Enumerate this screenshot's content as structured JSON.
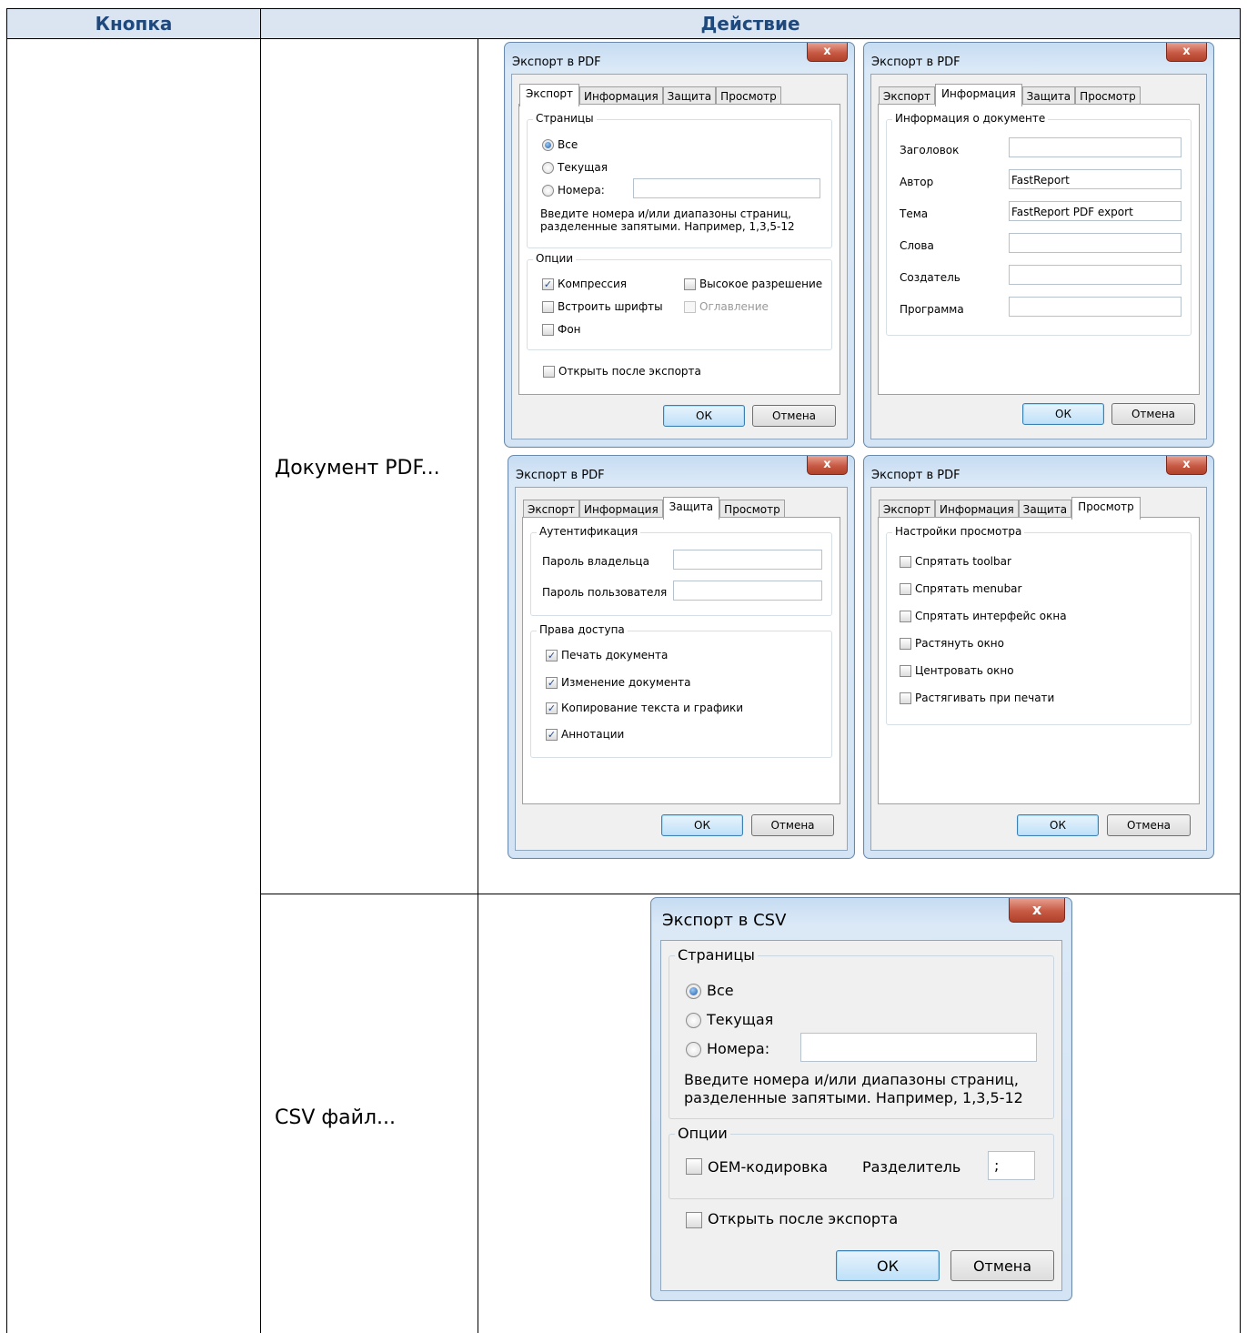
{
  "table": {
    "header": {
      "col1": "Кнопка",
      "col2": "Действие"
    },
    "rows": [
      {
        "label": "Документ PDF..."
      },
      {
        "label": "CSV файл..."
      }
    ],
    "header_bg": "#dbe5f1",
    "header_fg": "#1f497d"
  },
  "pdf_export": {
    "title": "Экспорт в PDF",
    "close_glyph": "x",
    "tabs": [
      "Экспорт",
      "Информация",
      "Защита",
      "Просмотр"
    ],
    "ok": "ОК",
    "cancel": "Отмена",
    "export_tab": {
      "pages_group": "Страницы",
      "radio_all": "Все",
      "radio_current": "Текущая",
      "radio_numbers": "Номера:",
      "numbers_value": "",
      "hint_line1": "Введите номера и/или диапазоны страниц,",
      "hint_line2": "разделенные запятыми. Например, 1,3,5-12",
      "options_group": "Опции",
      "compression": "Компрессия",
      "compression_checked": true,
      "high_res": "Высокое разрешение",
      "embed_fonts": "Встроить шрифты",
      "outline": "Оглавление",
      "background": "Фон",
      "open_after": "Открыть после экспорта",
      "selected": "Все"
    },
    "info_tab": {
      "group": "Информация о документе",
      "fields": [
        {
          "label": "Заголовок",
          "value": ""
        },
        {
          "label": "Автор",
          "value": "FastReport"
        },
        {
          "label": "Тема",
          "value": "FastReport PDF export"
        },
        {
          "label": "Слова",
          "value": ""
        },
        {
          "label": "Создатель",
          "value": ""
        },
        {
          "label": "Программа",
          "value": ""
        }
      ]
    },
    "security_tab": {
      "auth_group": "Аутентификация",
      "owner_password": "Пароль владельца",
      "user_password": "Пароль пользователя",
      "rights_group": "Права доступа",
      "rights": [
        {
          "label": "Печать документа",
          "checked": true
        },
        {
          "label": "Изменение документа",
          "checked": true
        },
        {
          "label": "Копирование текста и графики",
          "checked": true
        },
        {
          "label": "Аннотации",
          "checked": true
        }
      ]
    },
    "viewer_tab": {
      "group": "Настройки просмотра",
      "options": [
        {
          "label": "Спрятать toolbar",
          "checked": false
        },
        {
          "label": "Спрятать menubar",
          "checked": false
        },
        {
          "label": "Спрятать интерфейс окна",
          "checked": false
        },
        {
          "label": "Растянуть окно",
          "checked": false
        },
        {
          "label": "Центровать окно",
          "checked": false
        },
        {
          "label": "Растягивать при печати",
          "checked": false
        }
      ]
    }
  },
  "csv_export": {
    "title": "Экспорт в CSV",
    "close_glyph": "x",
    "pages_group": "Страницы",
    "radio_all": "Все",
    "radio_current": "Текущая",
    "radio_numbers": "Номера:",
    "numbers_value": "",
    "hint_line1": "Введите номера и/или диапазоны страниц,",
    "hint_line2": "разделенные запятыми. Например, 1,3,5-12",
    "options_group": "Опции",
    "oem": "OEM-кодировка",
    "separator_label": "Разделитель",
    "separator_value": ";",
    "open_after": "Открыть после экспорта",
    "ok": "ОК",
    "cancel": "Отмена",
    "selected": "Все"
  }
}
